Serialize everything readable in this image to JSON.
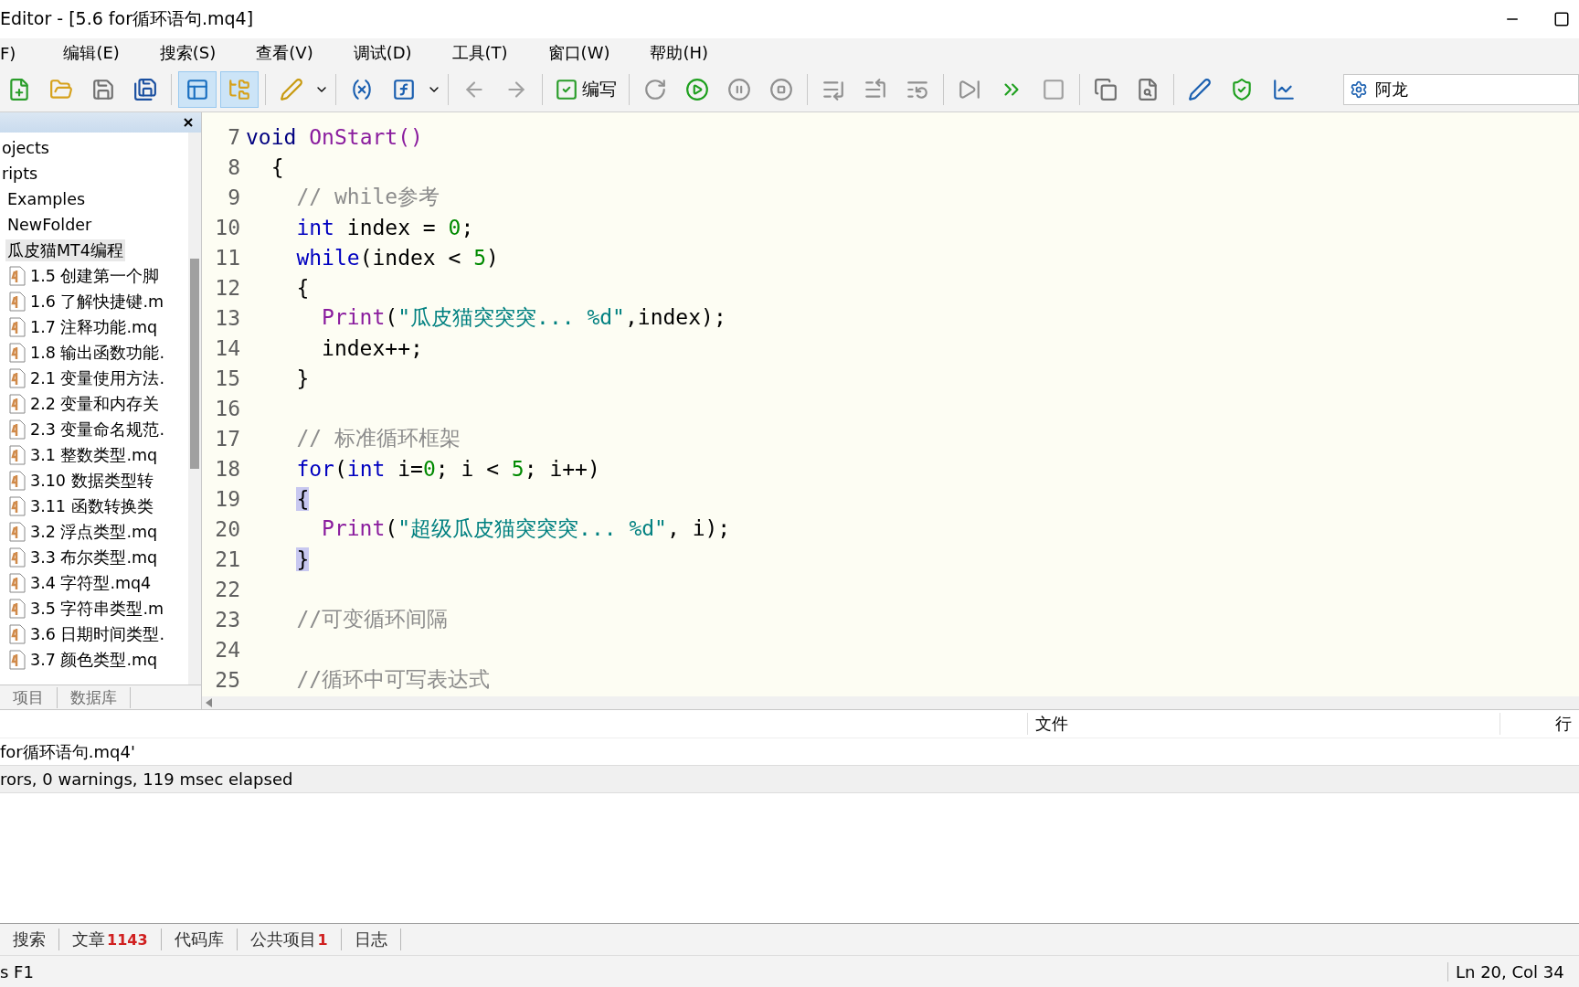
{
  "window": {
    "title": "Editor - [5.6 for循环语句.mq4]"
  },
  "menu": [
    "F)",
    "编辑(E)",
    "搜索(S)",
    "查看(V)",
    "调试(D)",
    "工具(T)",
    "窗口(W)",
    "帮助(H)"
  ],
  "toolbar": {
    "navigator_pressed": true,
    "toolbox_pressed": true,
    "compile_label": "编写",
    "search_value": "阿龙"
  },
  "navigator": {
    "tree": [
      {
        "label": "ojects",
        "selected": false
      },
      {
        "label": "ripts",
        "selected": false,
        "children": [
          {
            "label": "Examples",
            "selected": false
          },
          {
            "label": "NewFolder",
            "selected": false
          },
          {
            "label": "瓜皮猫MT4编程",
            "selected": true,
            "children": [
              {
                "label": "1.5 创建第一个脚",
                "selected": false,
                "kind": "file"
              },
              {
                "label": "1.6 了解快捷键.m",
                "selected": false,
                "kind": "file"
              },
              {
                "label": "1.7 注释功能.mq",
                "selected": false,
                "kind": "file"
              },
              {
                "label": "1.8 输出函数功能.",
                "selected": false,
                "kind": "file"
              },
              {
                "label": "2.1 变量使用方法.",
                "selected": false,
                "kind": "file"
              },
              {
                "label": "2.2 变量和内存关",
                "selected": false,
                "kind": "file"
              },
              {
                "label": "2.3 变量命名规范.",
                "selected": false,
                "kind": "file"
              },
              {
                "label": "3.1 整数类型.mq",
                "selected": false,
                "kind": "file"
              },
              {
                "label": "3.10 数据类型转",
                "selected": false,
                "kind": "file"
              },
              {
                "label": "3.11 函数转换类",
                "selected": false,
                "kind": "file"
              },
              {
                "label": "3.2 浮点类型.mq",
                "selected": false,
                "kind": "file"
              },
              {
                "label": "3.3 布尔类型.mq",
                "selected": false,
                "kind": "file"
              },
              {
                "label": "3.4 字符型.mq4",
                "selected": false,
                "kind": "file"
              },
              {
                "label": "3.5 字符串类型.m",
                "selected": false,
                "kind": "file"
              },
              {
                "label": "3.6 日期时间类型.",
                "selected": false,
                "kind": "file"
              },
              {
                "label": "3.7 颜色类型.mq",
                "selected": false,
                "kind": "file"
              }
            ]
          }
        ]
      }
    ],
    "tabs": [
      {
        "label": "项目",
        "selected": false
      },
      {
        "label": "数据库",
        "selected": false
      }
    ]
  },
  "editor": {
    "lines": [
      {
        "number": "7",
        "tokens": [
          {
            "kind": "type",
            "text": "void"
          },
          {
            "kind": "func",
            "text": " OnStart()"
          }
        ]
      },
      {
        "number": "8",
        "tokens": [
          {
            "kind": "plain",
            "text": "  {"
          }
        ]
      },
      {
        "number": "9",
        "tokens": [
          {
            "kind": "comment",
            "text": "    // while参考"
          }
        ]
      },
      {
        "number": "10",
        "tokens": [
          {
            "kind": "keyword",
            "text": "    int"
          },
          {
            "kind": "plain",
            "text": " index = "
          },
          {
            "kind": "number",
            "text": "0"
          },
          {
            "kind": "plain",
            "text": ";"
          }
        ]
      },
      {
        "number": "11",
        "tokens": [
          {
            "kind": "keyword",
            "text": "    while"
          },
          {
            "kind": "plain",
            "text": "(index < "
          },
          {
            "kind": "number",
            "text": "5"
          },
          {
            "kind": "plain",
            "text": ")"
          }
        ]
      },
      {
        "number": "12",
        "tokens": [
          {
            "kind": "plain",
            "text": "    {"
          }
        ]
      },
      {
        "number": "13",
        "tokens": [
          {
            "kind": "func",
            "text": "      Print"
          },
          {
            "kind": "plain",
            "text": "("
          },
          {
            "kind": "string",
            "text": "\"瓜皮猫突突突... %d\""
          },
          {
            "kind": "plain",
            "text": ",index);"
          }
        ]
      },
      {
        "number": "14",
        "tokens": [
          {
            "kind": "plain",
            "text": "      index++;"
          }
        ]
      },
      {
        "number": "15",
        "tokens": [
          {
            "kind": "plain",
            "text": "    }"
          }
        ]
      },
      {
        "number": "16"
      },
      {
        "number": "17",
        "tokens": [
          {
            "kind": "comment",
            "text": "    // 标准循环框架"
          }
        ]
      },
      {
        "number": "18",
        "tokens": [
          {
            "kind": "keyword",
            "text": "    for"
          },
          {
            "kind": "plain",
            "text": "("
          },
          {
            "kind": "keyword",
            "text": "int"
          },
          {
            "kind": "plain",
            "text": " i="
          },
          {
            "kind": "number",
            "text": "0"
          },
          {
            "kind": "plain",
            "text": "; i < "
          },
          {
            "kind": "number",
            "text": "5"
          },
          {
            "kind": "plain",
            "text": "; i++)"
          }
        ]
      },
      {
        "number": "19",
        "tokens": [
          {
            "kind": "match",
            "text": "    {"
          }
        ]
      },
      {
        "number": "20",
        "tokens": [
          {
            "kind": "func",
            "text": "      Print"
          },
          {
            "kind": "plain",
            "text": "("
          },
          {
            "kind": "string",
            "text": "\"超级瓜皮猫突突突... %d\""
          },
          {
            "kind": "plain",
            "text": ", i);"
          }
        ]
      },
      {
        "number": "21",
        "tokens": [
          {
            "kind": "match",
            "text": "    }"
          }
        ]
      },
      {
        "number": "22"
      },
      {
        "number": "23",
        "tokens": [
          {
            "kind": "comment",
            "text": "    //可变循环间隔"
          }
        ]
      },
      {
        "number": "24"
      },
      {
        "number": "25",
        "tokens": [
          {
            "kind": "comment",
            "text": "    //循环中可写表达式"
          }
        ]
      }
    ]
  },
  "output": {
    "columns": [
      "文件",
      "行"
    ],
    "rows": [
      {
        "text": "for循环语句.mq4'",
        "shaded": false
      },
      {
        "text": "rors, 0 warnings, 119 msec elapsed",
        "shaded": true
      }
    ]
  },
  "bottom_tabs": [
    {
      "label": "搜索"
    },
    {
      "label": "文章",
      "badge": "1143"
    },
    {
      "label": "代码库"
    },
    {
      "label": "公共项目",
      "badge": "1"
    },
    {
      "label": "日志"
    }
  ],
  "status_bar": {
    "hint": "s F1",
    "position": "Ln 20, Col 34"
  }
}
